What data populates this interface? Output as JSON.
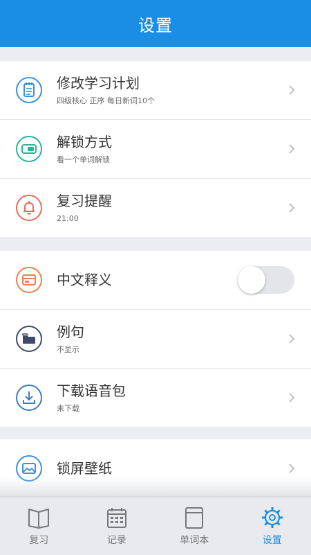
{
  "header": {
    "title": "设置"
  },
  "groups": [
    {
      "items": [
        {
          "title": "修改学习计划",
          "subtitle": "四级核心 正序 每日新词10个",
          "icon": "notebook-icon",
          "color": "#3d8fd9"
        },
        {
          "title": "解锁方式",
          "subtitle": "看一个单词解锁",
          "icon": "toggle-key-icon",
          "color": "#25b39a"
        },
        {
          "title": "复习提醒",
          "subtitle": "21:00",
          "icon": "bell-icon",
          "color": "#ea6b5a"
        }
      ]
    },
    {
      "items": [
        {
          "title": "中文释义",
          "icon": "card-icon",
          "color": "#ef7f4a",
          "toggle_on": false
        },
        {
          "title": "例句",
          "subtitle": "不显示",
          "icon": "folder-icon",
          "color": "#3f4a6b"
        },
        {
          "title": "下载语音包",
          "subtitle": "未下载",
          "icon": "download-icon",
          "color": "#3d7bbf"
        }
      ]
    },
    {
      "items": [
        {
          "title": "锁屏壁纸",
          "icon": "image-icon",
          "color": "#3d8fd9"
        }
      ]
    }
  ],
  "tabs": [
    {
      "label": "复习",
      "icon": "book-icon",
      "active": false
    },
    {
      "label": "记录",
      "icon": "calendar-icon",
      "active": false
    },
    {
      "label": "单词本",
      "icon": "wordbook-icon",
      "active": false
    },
    {
      "label": "设置",
      "icon": "gear-icon",
      "active": true
    }
  ],
  "colors": {
    "accent": "#1a8ee4",
    "tab_inactive": "#777777"
  }
}
